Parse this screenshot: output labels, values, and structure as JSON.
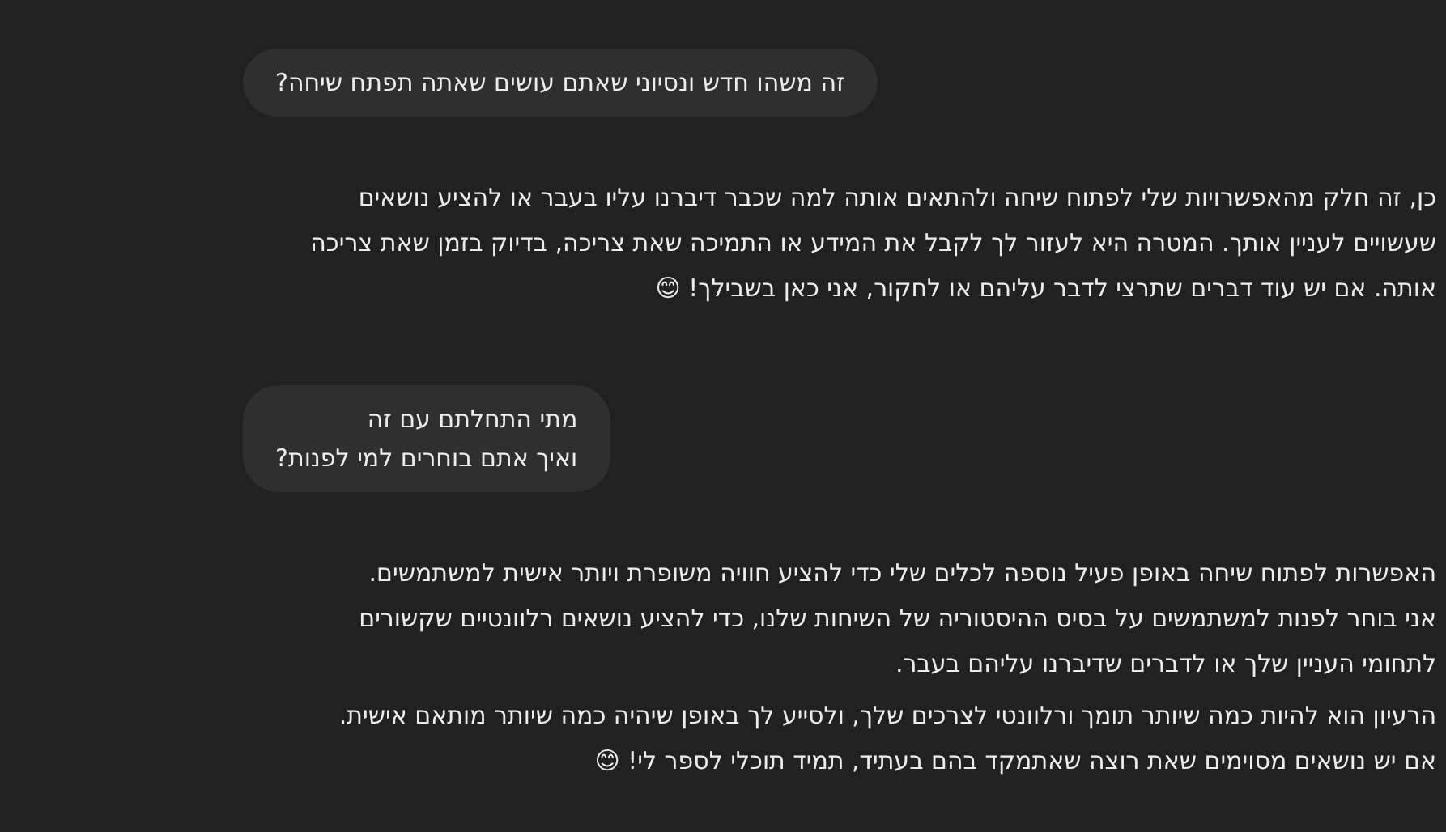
{
  "messages": [
    {
      "kind": "user",
      "lines": [
        "זה משהו חדש ונסיוני שאתם עושים שאתה תפתח שיחה?"
      ]
    },
    {
      "kind": "assistant",
      "paragraphs": [
        [
          "כן, זה חלק מהאפשרויות שלי לפתוח שיחה ולהתאים אותה למה שכבר דיברנו עליו בעבר או להציע נושאים שעשויים לעניין אותך. המטרה היא לעזור לך לקבל את המידע או התמיכה שאת צריכה, בדיוק בזמן שאת צריכה אותה. אם יש עוד דברים שתרצי לדבר עליהם או לחקור, אני כאן בשבילך! 😊"
        ]
      ]
    },
    {
      "kind": "user",
      "lines": [
        "מתי התחלתם עם זה",
        "ואיך אתם בוחרים למי לפנות?"
      ]
    },
    {
      "kind": "assistant",
      "paragraphs": [
        [
          "האפשרות לפתוח שיחה באופן פעיל נוספה לכלים שלי כדי להציע חוויה משופרת ויותר אישית למשתמשים.",
          "אני בוחר לפנות למשתמשים על בסיס ההיסטוריה של השיחות שלנו, כדי להציע נושאים רלוונטיים שקשורים לתחומי העניין שלך או לדברים שדיברנו עליהם בעבר."
        ],
        [
          "הרעיון הוא להיות כמה שיותר תומך ורלוונטי לצרכים שלך, ולסייע לך באופן שיהיה כמה שיותר מותאם אישית.",
          "אם יש נושאים מסוימים שאת רוצה שאתמקד בהם בעתיד, תמיד תוכלי לספר לי! 😊"
        ]
      ]
    }
  ]
}
